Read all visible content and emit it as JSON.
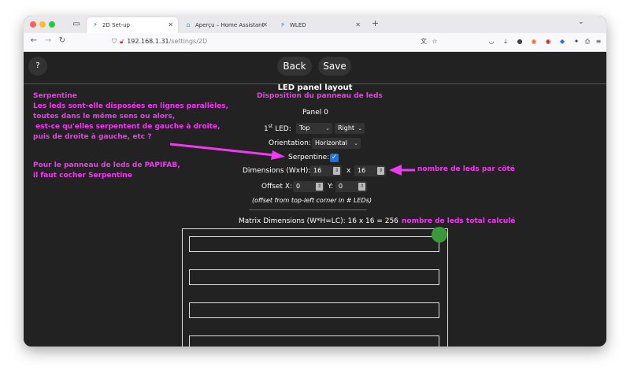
{
  "browser": {
    "tabs": [
      {
        "label": "2D Set-up",
        "active": true
      },
      {
        "label": "Aperçu – Home Assistant",
        "active": false
      },
      {
        "label": "WLED",
        "active": false
      }
    ],
    "url_host": "192.168.1.31",
    "url_path": "/settings/2D"
  },
  "toolbar": {
    "help_label": "?",
    "back_label": "Back",
    "save_label": "Save"
  },
  "panel": {
    "heading": "LED panel layout",
    "panel_label": "Panel 0",
    "first_led_label": "1st LED:",
    "first_led_vertical": "Top",
    "first_led_horizontal": "Right",
    "orientation_label": "Orientation:",
    "orientation_value": "Horizontal",
    "serpentine_label": "Serpentine:",
    "serpentine_checked": true,
    "dimensions_label": "Dimensions (WxH):",
    "width": "16",
    "height": "16",
    "x_sep": "x",
    "offset_x_label": "Offset X:",
    "offset_x": "0",
    "offset_y_label": "Y:",
    "offset_y": "0",
    "offset_note": "(offset from top-left corner in # LEDs)",
    "matrix_dimensions": "Matrix Dimensions (W*H=LC): 16 x 16 = 256"
  },
  "annotations": {
    "serpentine_title": "Serpentine",
    "serpentine_lines": [
      "Les leds sont-elle disposées en lignes parallèles,",
      "toutes dans le même sens ou alors,",
      " est-ce qu'elles serpentent de gauche à droite,",
      "puis de droite à gauche, etc ?"
    ],
    "papifab_lines": [
      "Pour le panneau de leds de PAPIFAB,",
      "il faut cocher Serpentine"
    ],
    "subtitle": "Disposition du panneau de leds",
    "per_side": "nombre de leds par côté",
    "total": "nombre de leds total calculé",
    "color": "#f039f0"
  },
  "colors": {
    "background": "#222222",
    "button": "#333333",
    "checkbox": "#1a73e8",
    "start_led": "#3a9a3a"
  }
}
